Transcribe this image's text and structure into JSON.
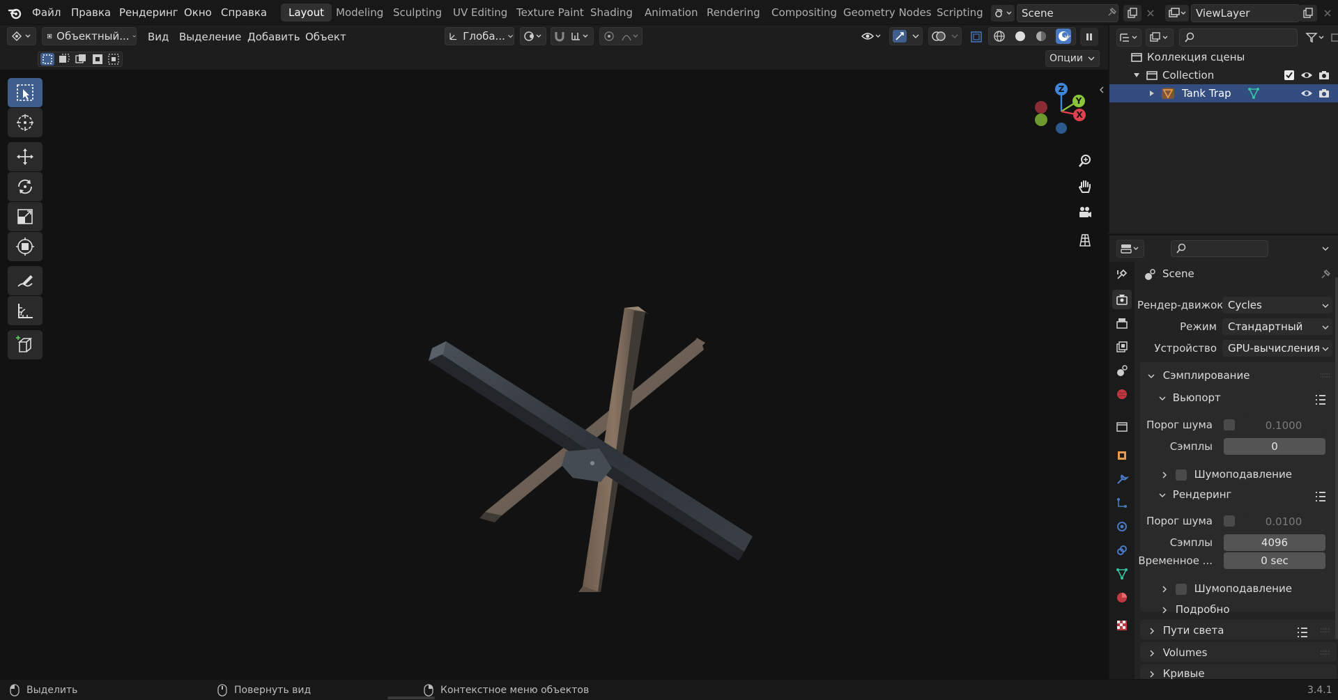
{
  "menu": {
    "file": "Файл",
    "edit": "Правка",
    "render": "Рендеринг",
    "window": "Окно",
    "help": "Справка"
  },
  "workspaces": [
    "Layout",
    "Modeling",
    "Sculpting",
    "UV Editing",
    "Texture Paint",
    "Shading",
    "Animation",
    "Rendering",
    "Compositing",
    "Geometry Nodes",
    "Scripting"
  ],
  "active_workspace": "Layout",
  "scene_selector": "Scene",
  "view_layer_selector": "ViewLayer",
  "viewport_header": {
    "mode": "Объектный...",
    "view": "Вид",
    "select": "Выделение",
    "add": "Добавить",
    "object": "Объект",
    "transform_orientation": "Глоба...",
    "options": "Опции"
  },
  "gizmo": {
    "x": "X",
    "y": "Y",
    "z": "Z"
  },
  "outliner": {
    "scene_collection": "Коллекция сцены",
    "collection": "Collection",
    "object": "Tank Trap"
  },
  "properties": {
    "context": "Scene",
    "render_engine_label": "Рендер-движок",
    "render_engine": "Cycles",
    "mode_label": "Режим",
    "mode": "Стандартный",
    "device_label": "Устройство",
    "device": "GPU-вычисления",
    "sampling": "Сэмплирование",
    "viewport": "Вьюпорт",
    "noise_threshold_label": "Порог шума",
    "viewport_noise_threshold": "0.1000",
    "samples_label": "Сэмплы",
    "viewport_samples": "0",
    "denoise": "Шумоподавление",
    "render": "Рендеринг",
    "render_noise_threshold": "0.0100",
    "render_samples": "4096",
    "time_limit_label": "Временное ...",
    "time_limit": "0 sec",
    "render_denoise": "Шумоподавление",
    "advanced": "Подробно",
    "light_paths": "Пути света",
    "volumes": "Volumes",
    "curves": "Кривые"
  },
  "status": {
    "select": "Выделить",
    "rotate_view": "Повернуть вид",
    "context_menu": "Контекстное меню объектов",
    "version": "3.4.1"
  },
  "colors": {
    "accent_blue": "#4a79c4",
    "selected_row": "#334d80",
    "axis_x": "#e0414f",
    "axis_y": "#8bc63a",
    "axis_z": "#3d86d9",
    "object_icon": "#e59a4f",
    "mesh_icon": "#35c4a3"
  }
}
